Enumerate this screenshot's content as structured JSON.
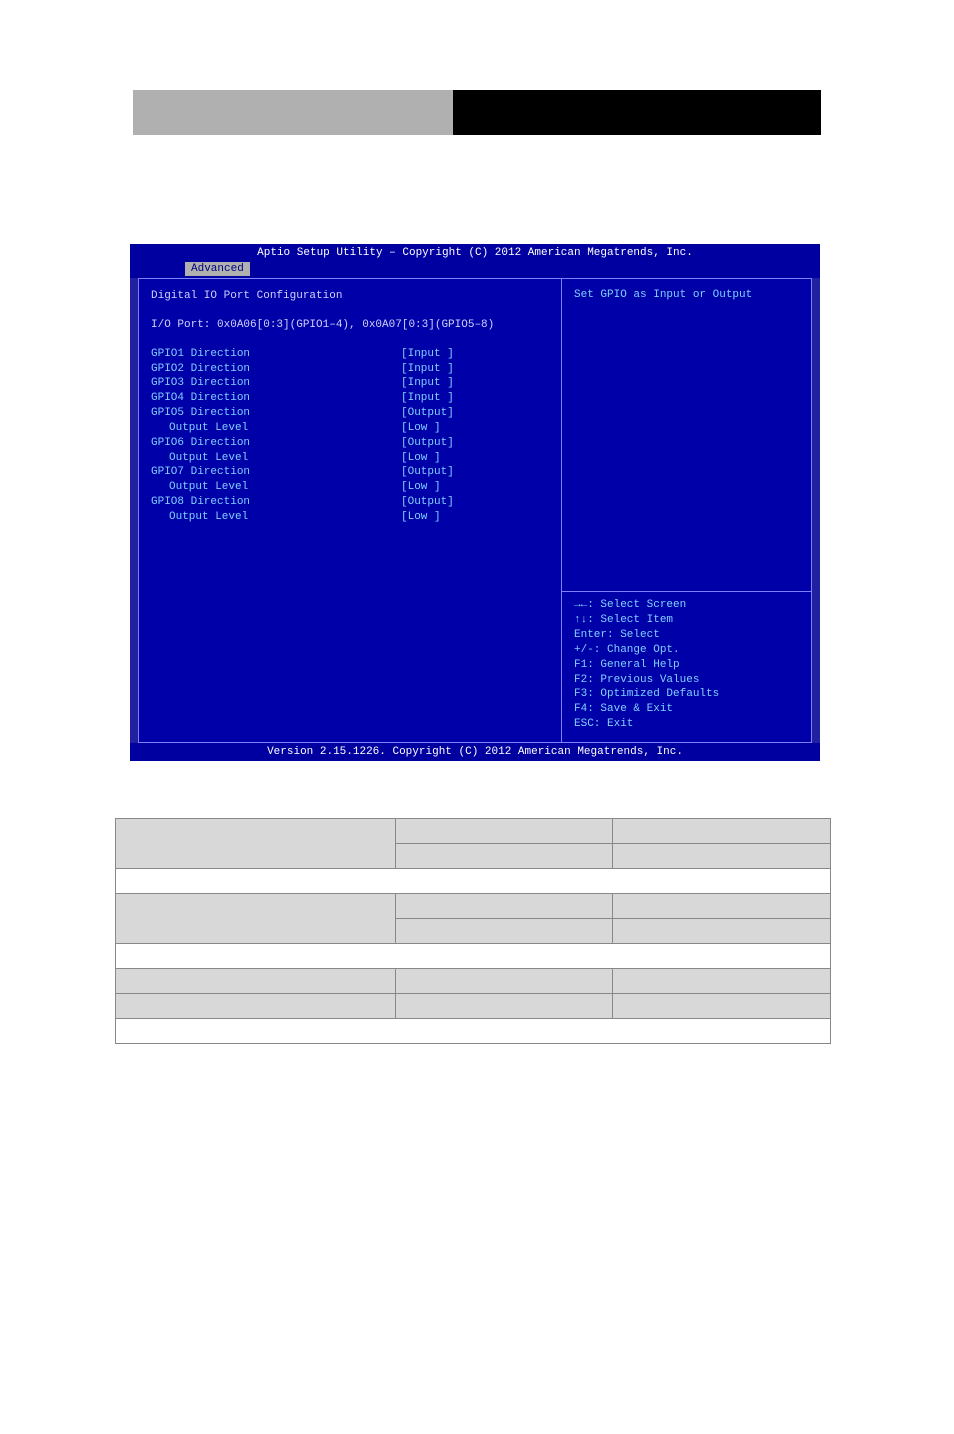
{
  "bios": {
    "top_bar": "Aptio Setup Utility – Copyright (C) 2012 American Megatrends, Inc.",
    "tab_active": "Advanced",
    "heading": "Digital IO Port Configuration",
    "ioport_line": "I/O Port: 0x0A06[0:3](GPIO1–4), 0x0A07[0:3](GPIO5–8)",
    "rows": [
      {
        "label": "GPIO1  Direction",
        "value": "[Input ]"
      },
      {
        "label": "GPIO2  Direction",
        "value": "[Input ]"
      },
      {
        "label": "GPIO3  Direction",
        "value": "[Input ]"
      },
      {
        "label": "GPIO4  Direction",
        "value": "[Input ]"
      },
      {
        "label": "GPIO5  Direction",
        "value": "[Output]"
      },
      {
        "label": "Output Level",
        "value": "[Low   ]",
        "indent": true
      },
      {
        "label": "GPIO6  Direction",
        "value": "[Output]"
      },
      {
        "label": "Output Level",
        "value": "[Low   ]",
        "indent": true
      },
      {
        "label": "GPIO7  Direction",
        "value": "[Output]"
      },
      {
        "label": "Output Level",
        "value": "[Low   ]",
        "indent": true
      },
      {
        "label": "GPIO8  Direction",
        "value": "[Output]"
      },
      {
        "label": "Output Level",
        "value": "[Low   ]",
        "indent": true
      }
    ],
    "help_top": "Set GPIO as Input or Output",
    "nav_help": [
      "→←: Select Screen",
      "↑↓: Select Item",
      "Enter: Select",
      "+/-: Change Opt.",
      "F1: General Help",
      "F2: Previous Values",
      "F3: Optimized Defaults",
      "F4: Save & Exit",
      "ESC: Exit"
    ],
    "footer": "Version 2.15.1226. Copyright (C) 2012 American Megatrends, Inc."
  },
  "table": {
    "rows": [
      [
        {
          "text": "",
          "class": "gray-cell col1",
          "rowspan": 2
        },
        {
          "text": "",
          "class": "gray-cell col2"
        },
        {
          "text": "",
          "class": "gray-cell col3"
        }
      ],
      [
        {
          "text": "",
          "class": "gray-cell col2"
        },
        {
          "text": "",
          "class": "gray-cell col3"
        }
      ],
      [
        {
          "text": "",
          "class": "white-cell span-row",
          "colspan": 3
        }
      ],
      [
        {
          "text": "",
          "class": "gray-cell col1",
          "rowspan": 2
        },
        {
          "text": "",
          "class": "gray-cell col2"
        },
        {
          "text": "",
          "class": "gray-cell col3"
        }
      ],
      [
        {
          "text": "",
          "class": "gray-cell col2"
        },
        {
          "text": "",
          "class": "gray-cell col3"
        }
      ],
      [
        {
          "text": "",
          "class": "white-cell span-row",
          "colspan": 3
        }
      ],
      [
        {
          "text": "",
          "class": "gray-cell col1"
        },
        {
          "text": "",
          "class": "gray-cell col2"
        },
        {
          "text": "",
          "class": "gray-cell col3"
        }
      ],
      [
        {
          "text": "",
          "class": "gray-cell col1"
        },
        {
          "text": "",
          "class": "gray-cell col2"
        },
        {
          "text": "",
          "class": "gray-cell col3"
        }
      ],
      [
        {
          "text": "",
          "class": "white-cell span-row",
          "colspan": 3
        }
      ]
    ]
  }
}
